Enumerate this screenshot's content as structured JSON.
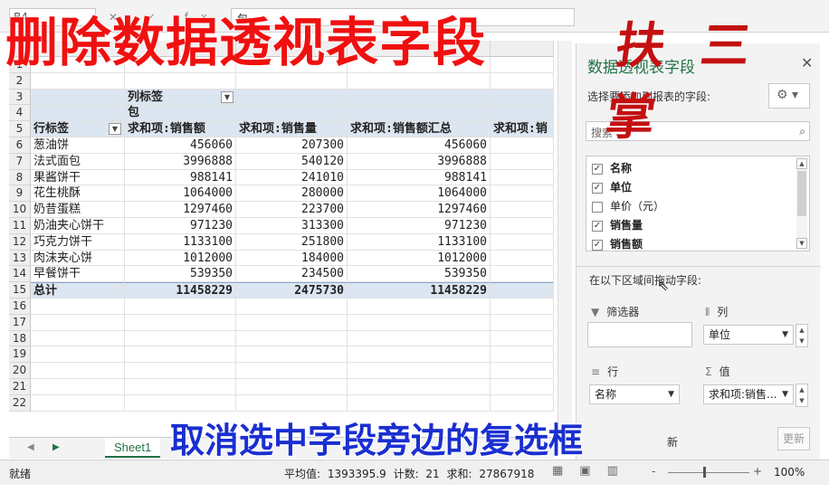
{
  "overlay": {
    "title": "删除数据透视表字段",
    "signature": "扶三掌",
    "subtitle": "取消选中字段旁边的复选框"
  },
  "formula_bar": {
    "namebox": "B4",
    "icons": "✕ ✓ fx",
    "value": "包"
  },
  "grid": {
    "rows": [
      {
        "n": "1"
      },
      {
        "n": "2"
      },
      {
        "n": "3",
        "b": "列标签"
      },
      {
        "n": "4",
        "b": "包"
      },
      {
        "n": "5",
        "a": "行标签",
        "b": "求和项:销售额",
        "c": "求和项:销售量",
        "d": "求和项:销售额汇总",
        "e": "求和项:销"
      },
      {
        "n": "6",
        "a": "葱油饼",
        "b": "456060",
        "c": "207300",
        "d": "456060"
      },
      {
        "n": "7",
        "a": "法式面包",
        "b": "3996888",
        "c": "540120",
        "d": "3996888"
      },
      {
        "n": "8",
        "a": "果酱饼干",
        "b": "988141",
        "c": "241010",
        "d": "988141"
      },
      {
        "n": "9",
        "a": "花生桃酥",
        "b": "1064000",
        "c": "280000",
        "d": "1064000"
      },
      {
        "n": "10",
        "a": "奶昔蛋糕",
        "b": "1297460",
        "c": "223700",
        "d": "1297460"
      },
      {
        "n": "11",
        "a": "奶油夹心饼干",
        "b": "971230",
        "c": "313300",
        "d": "971230"
      },
      {
        "n": "12",
        "a": "巧克力饼干",
        "b": "1133100",
        "c": "251800",
        "d": "1133100"
      },
      {
        "n": "13",
        "a": "肉沫夹心饼",
        "b": "1012000",
        "c": "184000",
        "d": "1012000"
      },
      {
        "n": "14",
        "a": "早餐饼干",
        "b": "539350",
        "c": "234500",
        "d": "539350"
      },
      {
        "n": "15",
        "a": "总计",
        "b": "11458229",
        "c": "2475730",
        "d": "11458229"
      },
      {
        "n": "16"
      },
      {
        "n": "17"
      },
      {
        "n": "18"
      },
      {
        "n": "19"
      },
      {
        "n": "20"
      },
      {
        "n": "21"
      },
      {
        "n": "22"
      }
    ]
  },
  "tabs": {
    "sheet1": "Sheet1",
    "nav_prev": "◀",
    "nav_next": "▶"
  },
  "status": {
    "ready": "就绪",
    "stats": "平均值: 1393395.9   计数: 21   求和: 27867918",
    "zoom_minus": "-",
    "zoom_plus": "+",
    "zoom": "100%"
  },
  "pane": {
    "title": "数据透视表字段",
    "close": "✕",
    "subtitle": "选择要添加到报表的字段:",
    "gear": "⚙ ▾",
    "search_placeholder": "搜索",
    "fields": [
      {
        "label": "名称",
        "checked": true
      },
      {
        "label": "单位",
        "checked": true
      },
      {
        "label": "单价（元）",
        "checked": false
      },
      {
        "label": "销售量",
        "checked": true
      },
      {
        "label": "销售额",
        "checked": true
      }
    ],
    "drag_label": "在以下区域间拖动字段:",
    "filters_label": "筛选器",
    "columns_label": "列",
    "rows_label": "行",
    "values_label": "值",
    "columns_item": "单位",
    "rows_item": "名称",
    "values_item": "求和项:销售...",
    "defer": "新",
    "update": "更新"
  }
}
